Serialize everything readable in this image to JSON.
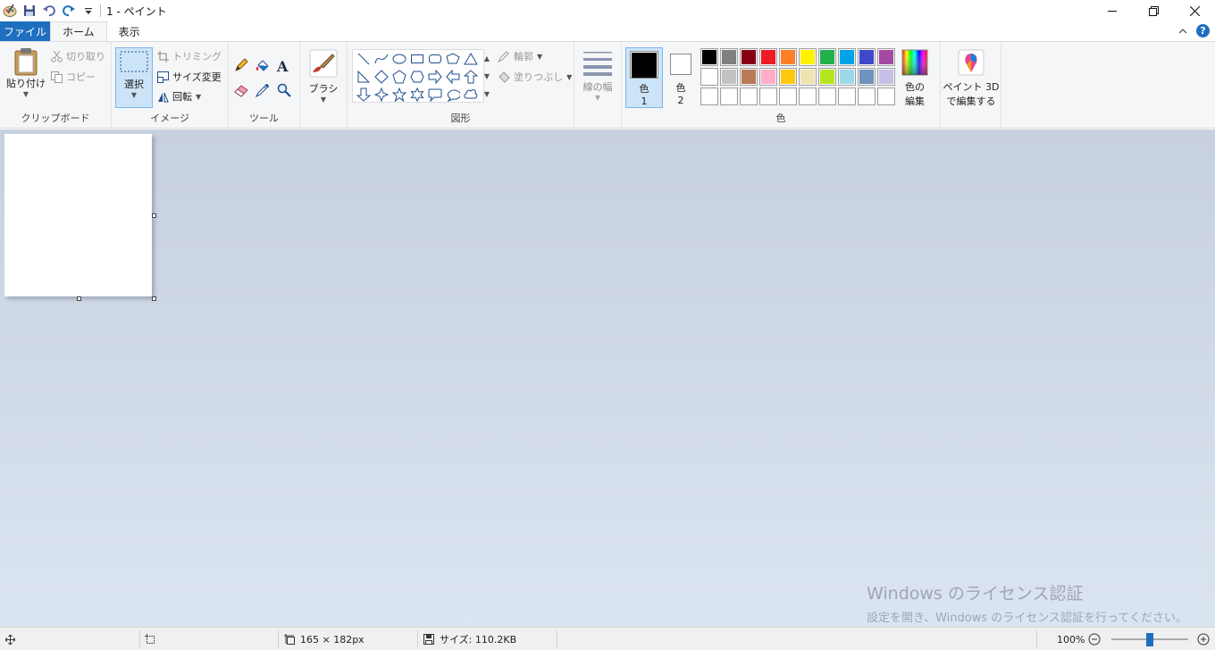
{
  "window": {
    "title": "1 - ペイント"
  },
  "tabs": {
    "file": "ファイル",
    "home": "ホーム",
    "view": "表示"
  },
  "clipboard": {
    "paste": "貼り付け",
    "cut": "切り取り",
    "copy": "コピー",
    "group_label": "クリップボード"
  },
  "image": {
    "select": "選択",
    "crop": "トリミング",
    "resize": "サイズ変更",
    "rotate": "回転",
    "group_label": "イメージ"
  },
  "tools": {
    "group_label": "ツール"
  },
  "brushes": {
    "label": "ブラシ"
  },
  "shapes": {
    "outline": "輪郭",
    "fill": "塗りつぶし",
    "group_label": "図形",
    "items": [
      "line-icon",
      "curve-icon",
      "oval-icon",
      "rectangle-icon",
      "rounded-rectangle-icon",
      "polygon-icon",
      "triangle-icon",
      "right-triangle-icon",
      "diamond-icon",
      "pentagon-icon",
      "hexagon-icon",
      "right-arrow-icon",
      "left-arrow-icon",
      "up-arrow-icon",
      "down-arrow-icon",
      "four-point-star-icon",
      "five-point-star-icon",
      "six-point-star-icon",
      "rounded-callout-icon",
      "oval-callout-icon",
      "cloud-callout-icon"
    ]
  },
  "size": {
    "label": "線の幅"
  },
  "colors": {
    "color1_label": "色",
    "color1_num": "1",
    "color2_label": "色",
    "color2_num": "2",
    "color1_value": "#000000",
    "color2_value": "#ffffff",
    "edit_line1": "色の",
    "edit_line2": "編集",
    "group_label": "色",
    "palette_row1": [
      "#000000",
      "#7f7f7f",
      "#880015",
      "#ed1c24",
      "#ff7f27",
      "#fff200",
      "#22b14c",
      "#00a2e8",
      "#3f48cc",
      "#a349a4"
    ],
    "palette_row2": [
      "#ffffff",
      "#c3c3c3",
      "#b97a57",
      "#ffaec9",
      "#ffc90e",
      "#efe4b0",
      "#b5e61d",
      "#99d9ea",
      "#7092be",
      "#c8bfe7"
    ],
    "palette_row3": [
      "",
      "",
      "",
      "",
      "",
      "",
      "",
      "",
      "",
      ""
    ]
  },
  "paint3d": {
    "line1": "ペイント 3D",
    "line2": "で編集する"
  },
  "canvas": {
    "background": "#ffffff"
  },
  "watermark": {
    "title": "Windows のライセンス認証",
    "subtitle": "設定を開き、Windows のライセンス認証を行ってください。"
  },
  "status": {
    "dimensions": "165 × 182px",
    "filesize": "サイズ: 110.2KB",
    "zoom": "100%",
    "zoom_level": 1.0
  }
}
